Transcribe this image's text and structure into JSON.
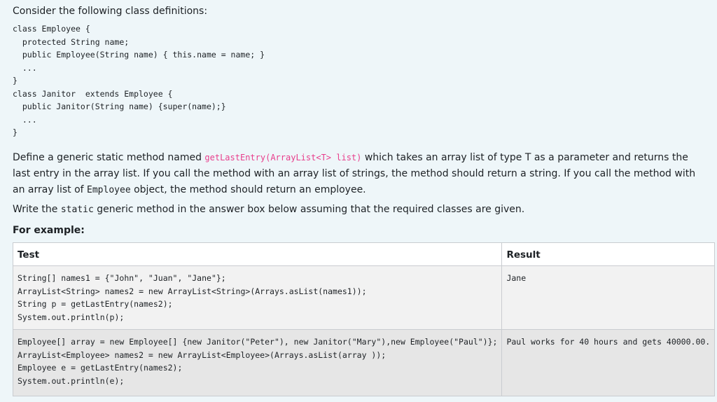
{
  "intro": "Consider the following class definitions:",
  "code_block": "class Employee {\n  protected String name;\n  public Employee(String name) { this.name = name; }\n  ...\n}\nclass Janitor  extends Employee {\n  public Janitor(String name) {super(name);}\n  ...\n}",
  "paragraph": {
    "part1": "Define a generic static method named ",
    "code1": "getLastEntry(ArrayList<T> list)",
    "part2": " which takes an array list of type T as a parameter and returns the last entry in the array list. If you call the method with an array list of strings, the method should return a string. If you call the method with an array list of ",
    "code2": "Employee",
    "part3": " object, the method should return an employee."
  },
  "write_line": {
    "part1": "Write the ",
    "code": "static",
    "part2": " generic method in the answer box below assuming that the required classes are given."
  },
  "for_example": "For example:",
  "table": {
    "headers": {
      "test": "Test",
      "result": "Result"
    },
    "rows": [
      {
        "test": "String[] names1 = {\"John\", \"Juan\", \"Jane\"};\nArrayList<String> names2 = new ArrayList<String>(Arrays.asList(names1));\nString p = getLastEntry(names2);\nSystem.out.println(p);",
        "result": "Jane"
      },
      {
        "test": "Employee[] array = new Employee[] {new Janitor(\"Peter\"), new Janitor(\"Mary\"),new Employee(\"Paul\")};\nArrayList<Employee> names2 = new ArrayList<Employee>(Arrays.asList(array ));\nEmployee e = getLastEntry(names2);\nSystem.out.println(e);",
        "result": "Paul works for 40 hours and gets 40000.00."
      }
    ]
  },
  "colors": {
    "background": "#eef6f9",
    "inline_code_accent": "#e83e8c",
    "text": "#1d2125"
  }
}
